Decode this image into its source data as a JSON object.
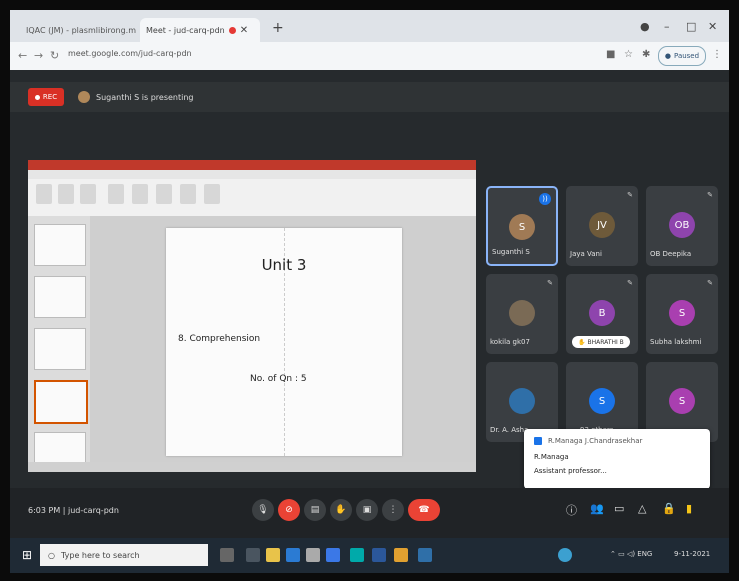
{
  "browser": {
    "tabs": [
      {
        "label": "IQAC (JM) - plasmlibirong.m - S"
      },
      {
        "label": "Meet - jud-carq-pdn"
      }
    ],
    "url": "meet.google.com/jud-carq-pdn",
    "profile_label": "Paused"
  },
  "meet": {
    "rec_label": "REC",
    "presenting_text": "Suganthi S is presenting",
    "time_code": "6:03 PM  |  jud-carq-pdn"
  },
  "slide": {
    "title": "Unit 3",
    "body": "8. Comprehension",
    "qn": "No. of Qn : 5"
  },
  "participants": [
    {
      "initial": "S",
      "name": "Suganthi S",
      "color": "#a07a55"
    },
    {
      "initial": "JV",
      "name": "Jaya Vani",
      "color": "#6e5a3a"
    },
    {
      "initial": "OB",
      "name": "OB Deepika",
      "color": "#8e44ad"
    },
    {
      "initial": "",
      "name": "kokila gk07",
      "color": "#7a6a55"
    },
    {
      "initial": "B",
      "name": "BHARATHI B",
      "color": "#8e44ad"
    },
    {
      "initial": "S",
      "name": "Subha lakshmi",
      "color": "#a93fb0"
    },
    {
      "initial": "",
      "name": "Dr. A. Asha",
      "color": "#2f6fa8"
    },
    {
      "initial": "S",
      "name": "93 others",
      "color": "#1a73e8"
    },
    {
      "initial": "S",
      "name": "",
      "color": "#a93fb0"
    }
  ],
  "notification": {
    "header": "R.Managa J.Chandrasekhar",
    "name": "R.Managa",
    "message": "Assistant professor..."
  },
  "taskbar": {
    "search_placeholder": "Type here to search",
    "date": "9-11-2021"
  }
}
